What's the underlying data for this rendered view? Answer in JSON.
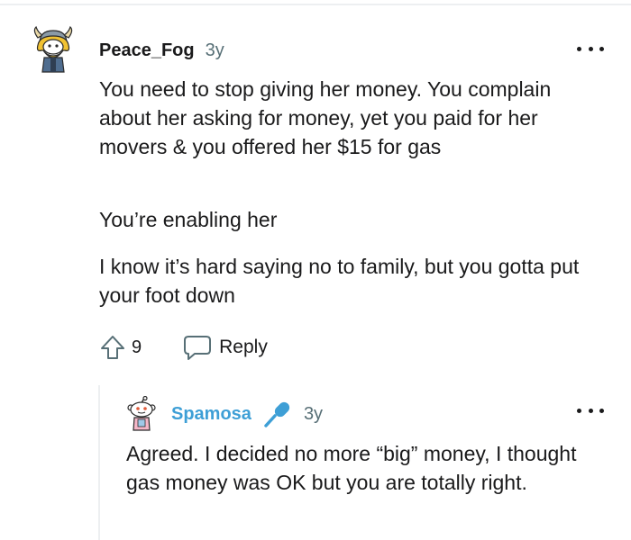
{
  "comment": {
    "username": "Peace_Fog",
    "time": "3y",
    "paragraphs": [
      "You need to stop giving her money. You complain about her asking for money, yet you paid for her movers & you offered her $15 for gas",
      "You’re enabling her",
      "I know it’s hard saying no to family, but you gotta put your foot down"
    ],
    "votes": "9",
    "reply_label": "Reply"
  },
  "reply": {
    "username": "Spamosa",
    "time": "3y",
    "paragraphs": [
      "Agreed. I decided no more “big” money, I thought gas money was OK but you are totally right."
    ]
  },
  "colors": {
    "text": "#1a1a1b",
    "meta": "#576f76",
    "reply_username": "#3e9fd6",
    "divider": "#edeff1"
  },
  "icons": {
    "comment_avatar": "viking-snoo-avatar",
    "reply_avatar": "snoo-avatar",
    "flair": "microphone-icon",
    "upvote": "upvote-arrow-icon",
    "reply": "speech-bubble-icon",
    "more": "more-options-icon"
  }
}
